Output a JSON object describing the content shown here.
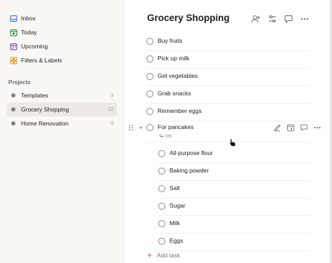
{
  "sidebar": {
    "nav": [
      {
        "label": "Inbox",
        "icon": "inbox-icon",
        "color": "#246fe0"
      },
      {
        "label": "Today",
        "icon": "today-icon",
        "color": "#058527"
      },
      {
        "label": "Upcoming",
        "icon": "upcoming-icon",
        "color": "#692fc2"
      },
      {
        "label": "Filters & Labels",
        "icon": "filters-labels-icon",
        "color": "#eb8909"
      }
    ],
    "projects_title": "Projects",
    "projects": [
      {
        "label": "Templates",
        "count": "3"
      },
      {
        "label": "Grocery Shopping",
        "count": "12"
      },
      {
        "label": "Home Renovation",
        "count": "5"
      }
    ]
  },
  "main": {
    "title": "Grocery Shopping",
    "header_icons": [
      "add-person-icon",
      "settings-sliders-icon",
      "comment-icon",
      "more-icon"
    ],
    "tasks": [
      {
        "label": "Buy fruits"
      },
      {
        "label": "Pick up milk"
      },
      {
        "label": "Get vegetables"
      },
      {
        "label": "Grab snacks"
      },
      {
        "label": "Remember eggs"
      },
      {
        "label": "For pancakes",
        "subtask_progress": "0/6"
      }
    ],
    "subtasks": [
      {
        "label": "All-purpose flour"
      },
      {
        "label": "Baking powder"
      },
      {
        "label": "Salt"
      },
      {
        "label": "Sugar"
      },
      {
        "label": "Milk"
      },
      {
        "label": "Eggs"
      }
    ],
    "add_task_label": "Add task"
  }
}
